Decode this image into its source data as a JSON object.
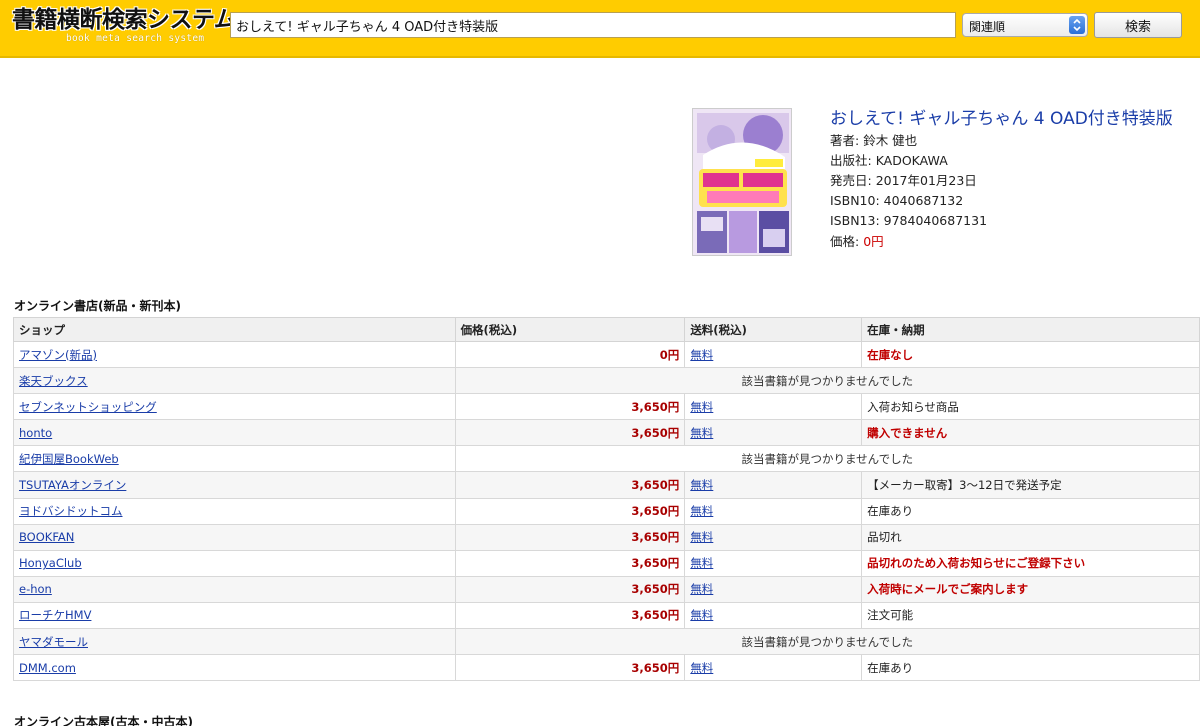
{
  "header": {
    "logo_main": "書籍横断検索システム",
    "logo_sub": "book meta search system",
    "search_value": "おしえて! ギャル子ちゃん 4 OAD付き特装版",
    "sort_selected": "関連順",
    "search_button": "検索",
    "accent_color": "#ffcc00"
  },
  "book": {
    "title": "おしえて! ギャル子ちゃん 4 OAD付き特装版",
    "author_label": "著者: ",
    "author": "鈴木 健也",
    "publisher_label": "出版社: ",
    "publisher": "KADOKAWA",
    "release_label": "発売日: ",
    "release": "2017年01月23日",
    "isbn10_label": "ISBN10: ",
    "isbn10": "4040687132",
    "isbn13_label": "ISBN13: ",
    "isbn13": "9784040687131",
    "price_label": "価格: ",
    "price": "0円"
  },
  "online_section": {
    "title": "オンライン書店(新品・新刊本)",
    "columns": [
      "ショップ",
      "価格(税込)",
      "送料(税込)",
      "在庫・納期"
    ],
    "rows": [
      {
        "shop": "アマゾン(新品)",
        "price": "0円",
        "shipping": "無料",
        "stock": "在庫なし",
        "stock_red": true
      },
      {
        "shop": "楽天ブックス",
        "notfound": "該当書籍が見つかりませんでした"
      },
      {
        "shop": "セブンネットショッピング",
        "price": "3,650円",
        "shipping": "無料",
        "stock": "入荷お知らせ商品",
        "stock_red": false
      },
      {
        "shop": "honto",
        "price": "3,650円",
        "shipping": "無料",
        "stock": "購入できません",
        "stock_red": true
      },
      {
        "shop": "紀伊国屋BookWeb",
        "notfound": "該当書籍が見つかりませんでした"
      },
      {
        "shop": "TSUTAYAオンライン",
        "price": "3,650円",
        "shipping": "無料",
        "stock": "【メーカー取寄】3～12日で発送予定",
        "stock_red": false
      },
      {
        "shop": "ヨドバシドットコム",
        "price": "3,650円",
        "shipping": "無料",
        "stock": "在庫あり",
        "stock_red": false
      },
      {
        "shop": "BOOKFAN",
        "price": "3,650円",
        "shipping": "無料",
        "stock": "品切れ",
        "stock_red": false
      },
      {
        "shop": "HonyaClub",
        "price": "3,650円",
        "shipping": "無料",
        "stock": "品切れのため入荷お知らせにご登録下さい",
        "stock_red": true
      },
      {
        "shop": "e-hon",
        "price": "3,650円",
        "shipping": "無料",
        "stock": "入荷時にメールでご案内します",
        "stock_red": true
      },
      {
        "shop": "ローチケHMV",
        "price": "3,650円",
        "shipping": "無料",
        "stock": "注文可能",
        "stock_red": false
      },
      {
        "shop": "ヤマダモール",
        "notfound": "該当書籍が見つかりませんでした"
      },
      {
        "shop": "DMM.com",
        "price": "3,650円",
        "shipping": "無料",
        "stock": "在庫あり",
        "stock_red": false
      }
    ]
  },
  "used_section": {
    "title": "オンライン古本屋(古本・中古本)"
  }
}
